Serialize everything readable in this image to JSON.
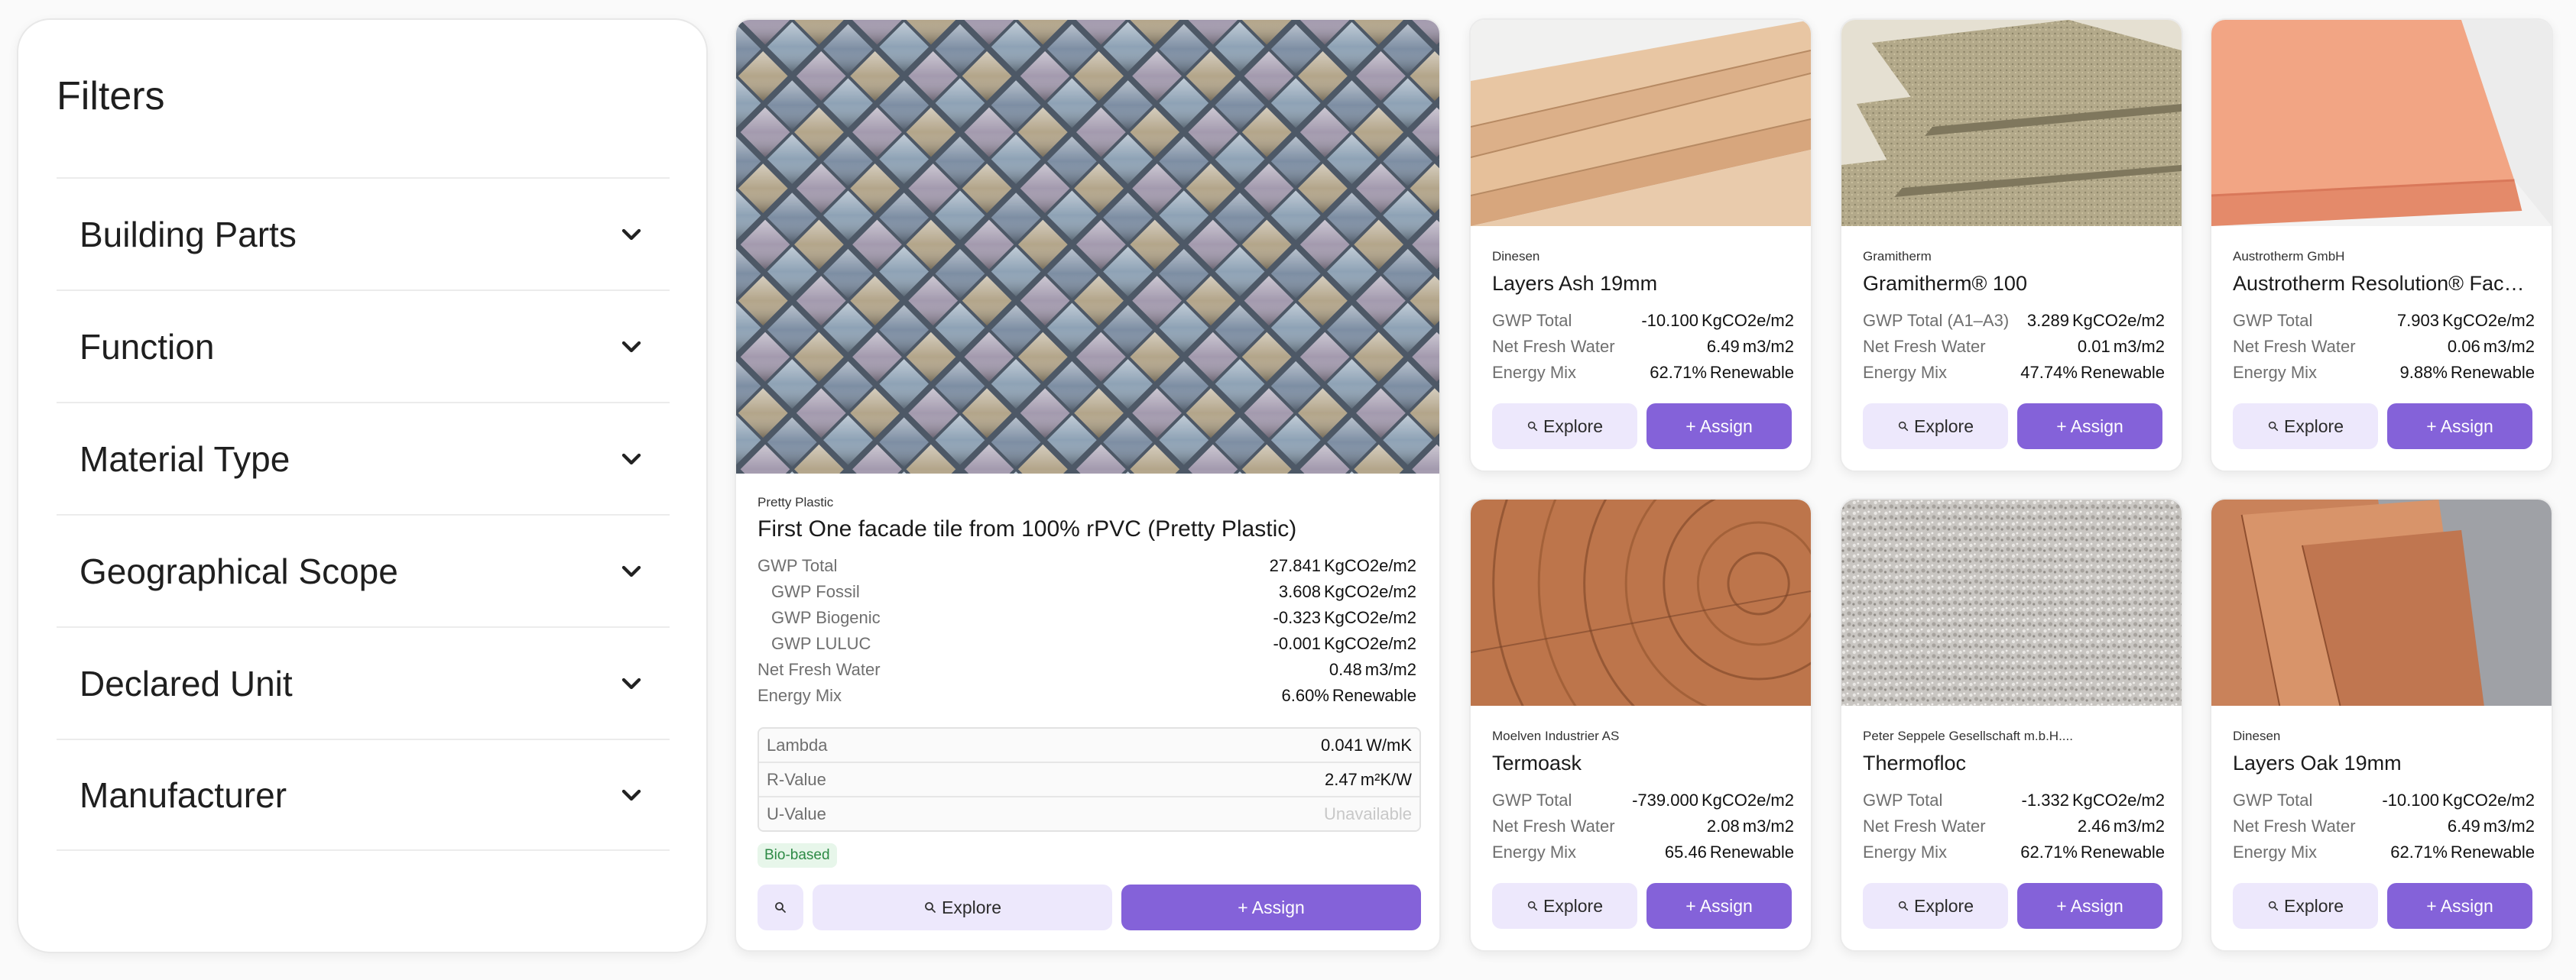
{
  "filters": {
    "title": "Filters",
    "items": [
      {
        "label": "Building Parts"
      },
      {
        "label": "Function"
      },
      {
        "label": "Material Type"
      },
      {
        "label": "Geographical Scope"
      },
      {
        "label": "Declared Unit"
      },
      {
        "label": "Manufacturer"
      }
    ]
  },
  "buttons": {
    "explore": "Explore",
    "assign": "+ Assign"
  },
  "featured": {
    "manufacturer": "Pretty Plastic",
    "title": "First One facade tile from 100% rPVC (Pretty Plastic)",
    "metrics": [
      {
        "label": "GWP Total",
        "value": "27.841",
        "unit": "KgCO2e/m2"
      },
      {
        "label": "GWP Fossil",
        "value": "3.608",
        "unit": "KgCO2e/m2"
      },
      {
        "label": "GWP Biogenic",
        "value": "-0.323",
        "unit": "KgCO2e/m2"
      },
      {
        "label": "GWP LULUC",
        "value": "-0.001",
        "unit": "KgCO2e/m2"
      },
      {
        "label": "Net Fresh Water",
        "value": "0.48",
        "unit": "m3/m2"
      },
      {
        "label": "Energy Mix",
        "value": "6.60%",
        "unit": "Renewable"
      }
    ],
    "thermal": [
      {
        "label": "Lambda",
        "value": "0.041",
        "unit": "W/mK"
      },
      {
        "label": "R-Value",
        "value": "2.47",
        "unit": "m²K/W"
      },
      {
        "label": "U-Value",
        "value": "Unavailable",
        "unit": ""
      }
    ],
    "badge": "Bio-based"
  },
  "cards": [
    {
      "manufacturer": "Dinesen",
      "title": "Layers Ash 19mm",
      "image": "ash-planks",
      "metrics": [
        {
          "label": "GWP Total",
          "value": "-10.100",
          "unit": "KgCO2e/m2"
        },
        {
          "label": "Net Fresh Water",
          "value": "6.49",
          "unit": "m3/m2"
        },
        {
          "label": "Energy Mix",
          "value": "62.71%",
          "unit": "Renewable"
        }
      ]
    },
    {
      "manufacturer": "Gramitherm",
      "title": "Gramitherm® 100",
      "image": "insulation-boards",
      "metrics": [
        {
          "label": "GWP Total (A1–A3)",
          "value": "3.289",
          "unit": "KgCO2e/m2"
        },
        {
          "label": "Net Fresh Water",
          "value": "0.01",
          "unit": "m3/m2"
        },
        {
          "label": "Energy Mix",
          "value": "47.74%",
          "unit": "Renewable"
        }
      ]
    },
    {
      "manufacturer": "Austrotherm GmbH",
      "title": "Austrotherm Resolution® Facade",
      "image": "pink-boards",
      "metrics": [
        {
          "label": "GWP Total",
          "value": "7.903",
          "unit": "KgCO2e/m2"
        },
        {
          "label": "Net Fresh Water",
          "value": "0.06",
          "unit": "m3/m2"
        },
        {
          "label": "Energy Mix",
          "value": "9.88%",
          "unit": "Renewable"
        }
      ]
    },
    {
      "manufacturer": "Moelven Industrier AS",
      "title": "Termoask",
      "image": "wood-rings",
      "metrics": [
        {
          "label": "GWP Total",
          "value": "-739.000",
          "unit": "KgCO2e/m2"
        },
        {
          "label": "Net Fresh Water",
          "value": "2.08",
          "unit": "m3/m2"
        },
        {
          "label": "Energy Mix",
          "value": "65.46",
          "unit": "Renewable"
        }
      ]
    },
    {
      "manufacturer": "Peter Seppele Gesellschaft m.b.H....",
      "title": "Thermofloc",
      "image": "cellulose-fibre",
      "metrics": [
        {
          "label": "GWP Total",
          "value": "-1.332",
          "unit": "KgCO2e/m2"
        },
        {
          "label": "Net Fresh Water",
          "value": "2.46",
          "unit": "m3/m2"
        },
        {
          "label": "Energy Mix",
          "value": "62.71%",
          "unit": "Renewable"
        }
      ]
    },
    {
      "manufacturer": "Dinesen",
      "title": "Layers Oak 19mm",
      "image": "oak-planks",
      "metrics": [
        {
          "label": "GWP Total",
          "value": "-10.100",
          "unit": "KgCO2e/m2"
        },
        {
          "label": "Net Fresh Water",
          "value": "6.49",
          "unit": "m3/m2"
        },
        {
          "label": "Energy Mix",
          "value": "62.71%",
          "unit": "Renewable"
        }
      ]
    }
  ]
}
